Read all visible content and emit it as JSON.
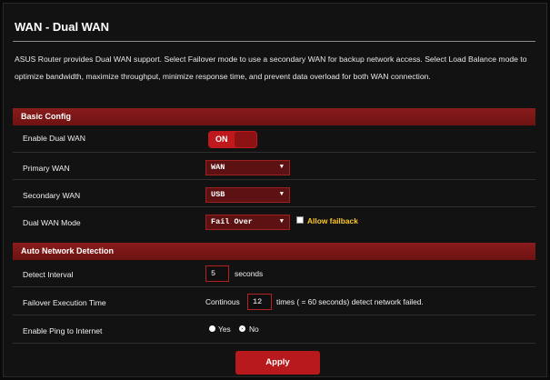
{
  "page": {
    "title": "WAN - Dual WAN",
    "description": "ASUS Router provides Dual WAN support. Select Failover mode to use a secondary WAN for backup network access. Select Load Balance mode to optimize bandwidth, maximize throughput, minimize response time, and prevent data overload for both WAN connection."
  },
  "basic_config": {
    "header": "Basic Config",
    "enable_dual_wan": {
      "label": "Enable Dual WAN",
      "toggle_text": "ON"
    },
    "primary_wan": {
      "label": "Primary WAN",
      "value": "WAN"
    },
    "secondary_wan": {
      "label": "Secondary WAN",
      "value": "USB"
    },
    "dual_wan_mode": {
      "label": "Dual WAN Mode",
      "value": "Fail Over",
      "fallback_label": "Allow failback",
      "fallback_checked": false
    }
  },
  "auto_detection": {
    "header": "Auto Network Detection",
    "detect_interval": {
      "label": "Detect Interval",
      "value": "5",
      "unit": "seconds"
    },
    "failover_execution": {
      "label": "Failover Execution Time",
      "prefix": "Continous",
      "value": "12",
      "suffix": "times ( = 60  seconds) detect network failed."
    },
    "ping": {
      "label": "Enable Ping to Internet",
      "yes": "Yes",
      "no": "No",
      "selected": "No"
    }
  },
  "apply_label": "Apply",
  "colors": {
    "accent": "#c0191d",
    "section_bar": "#7a1616",
    "warning": "#ffc726",
    "background": "#121212"
  }
}
